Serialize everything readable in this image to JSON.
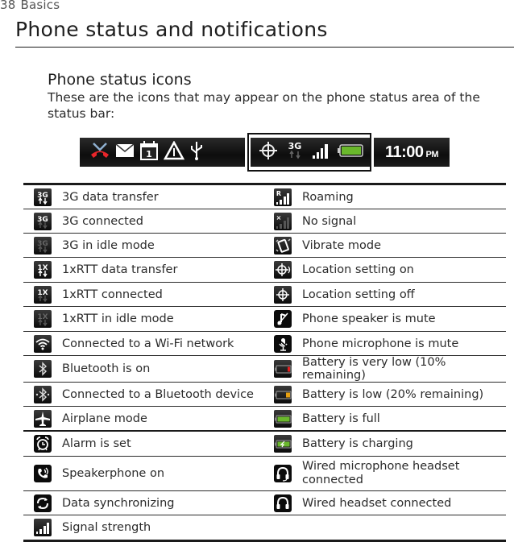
{
  "page": {
    "number": "38",
    "section": "Basics"
  },
  "chapter_title": "Phone status and notifications",
  "section_title": "Phone status icons",
  "intro_text": "These are the icons that may appear on the phone status area of the status bar:",
  "status_bar": {
    "left_icons": [
      "missed-call-icon",
      "mail-icon",
      "calendar-icon",
      "warning-icon",
      "usb-icon"
    ],
    "calendar_day": "1",
    "highlighted_icons": [
      "location-icon",
      "3g-icon",
      "signal-strength-icon",
      "battery-full-icon"
    ],
    "highlight_label": "3G",
    "clock_time": "11:00",
    "clock_ampm": "PM"
  },
  "colors": {
    "battery_full": "#6ab82c",
    "battery_very_low": "#e02020",
    "battery_low": "#e8a010",
    "missed_call_red": "#e8252a"
  },
  "icons_table": [
    {
      "left": {
        "icon": "3g-data-transfer-icon",
        "label": "3G data transfer"
      },
      "right": {
        "icon": "roaming-icon",
        "label": "Roaming"
      }
    },
    {
      "left": {
        "icon": "3g-connected-icon",
        "label": "3G connected"
      },
      "right": {
        "icon": "no-signal-icon",
        "label": "No signal"
      }
    },
    {
      "left": {
        "icon": "3g-idle-icon",
        "label": "3G in idle mode"
      },
      "right": {
        "icon": "vibrate-icon",
        "label": "Vibrate mode"
      }
    },
    {
      "left": {
        "icon": "1xrtt-data-transfer-icon",
        "label": "1xRTT data transfer"
      },
      "right": {
        "icon": "location-on-icon",
        "label": "Location setting on"
      }
    },
    {
      "left": {
        "icon": "1xrtt-connected-icon",
        "label": "1xRTT connected"
      },
      "right": {
        "icon": "location-off-icon",
        "label": "Location setting off"
      }
    },
    {
      "left": {
        "icon": "1xrtt-idle-icon",
        "label": "1xRTT in idle mode"
      },
      "right": {
        "icon": "speaker-mute-icon",
        "label": "Phone speaker is mute"
      }
    },
    {
      "left": {
        "icon": "wifi-icon",
        "label": "Connected to a Wi-Fi network"
      },
      "right": {
        "icon": "microphone-mute-icon",
        "label": "Phone microphone is mute"
      }
    },
    {
      "left": {
        "icon": "bluetooth-on-icon",
        "label": "Bluetooth is on"
      },
      "right": {
        "icon": "battery-very-low-icon",
        "label": "Battery is very low (10% remaining)"
      }
    },
    {
      "left": {
        "icon": "bluetooth-connected-icon",
        "label": "Connected to a Bluetooth device"
      },
      "right": {
        "icon": "battery-low-icon",
        "label": "Battery is low (20% remaining)"
      }
    },
    {
      "left": {
        "icon": "airplane-icon",
        "label": "Airplane mode"
      },
      "right": {
        "icon": "battery-full-icon",
        "label": "Battery is full"
      }
    },
    {
      "left": {
        "icon": "alarm-icon",
        "label": "Alarm is set"
      },
      "right": {
        "icon": "battery-charging-icon",
        "label": "Battery is charging"
      }
    },
    {
      "left": {
        "icon": "speakerphone-icon",
        "label": "Speakerphone on"
      },
      "right": {
        "icon": "microphone-headset-icon",
        "label": "Wired microphone headset connected"
      }
    },
    {
      "left": {
        "icon": "sync-icon",
        "label": "Data synchronizing"
      },
      "right": {
        "icon": "headset-icon",
        "label": "Wired headset connected"
      }
    },
    {
      "left": {
        "icon": "signal-strength-icon",
        "label": "Signal strength"
      },
      "right": null
    }
  ]
}
